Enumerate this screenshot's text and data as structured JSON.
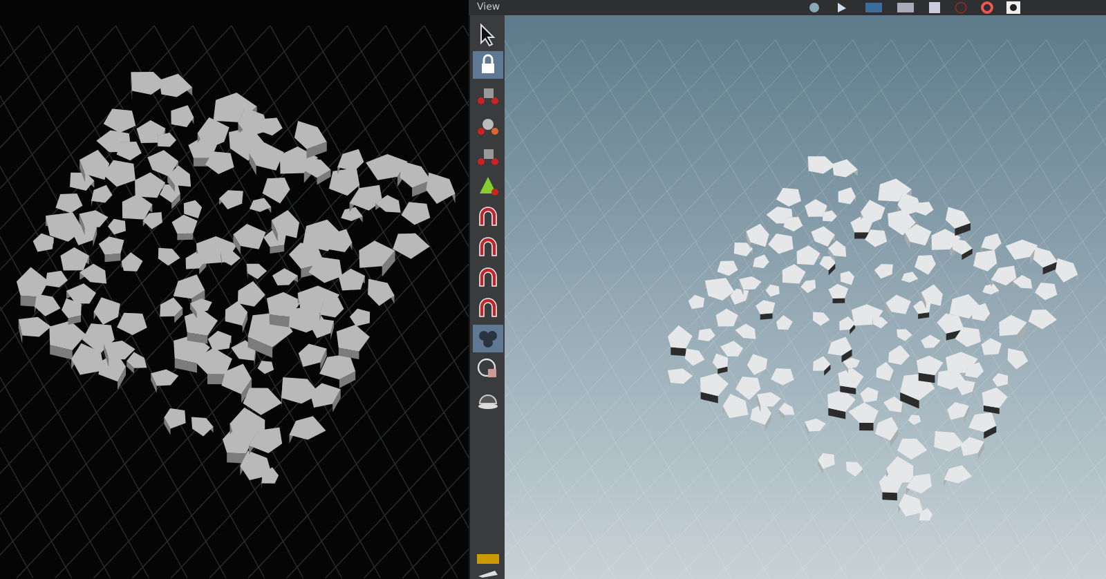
{
  "viewport_header": {
    "title": "View"
  },
  "tools": [
    {
      "kind": "pointer",
      "selected": false
    },
    {
      "kind": "lock",
      "selected": true
    },
    {
      "kind": "cube",
      "selected": false
    },
    {
      "kind": "sphere",
      "selected": false
    },
    {
      "kind": "cube",
      "selected": false
    },
    {
      "kind": "pyramid",
      "selected": false
    },
    {
      "kind": "magnet",
      "selected": false
    },
    {
      "kind": "magnet",
      "selected": false
    },
    {
      "kind": "magnet",
      "selected": false
    },
    {
      "kind": "magnet",
      "selected": false
    },
    {
      "kind": "cluster",
      "selected": true
    },
    {
      "kind": "circle",
      "selected": false
    },
    {
      "kind": "dome",
      "selected": false
    }
  ]
}
